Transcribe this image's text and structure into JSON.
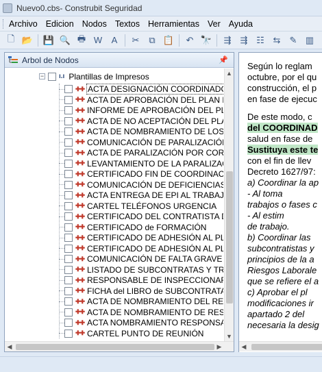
{
  "window": {
    "title": "Nuevo0.cbs- Construbit Seguridad"
  },
  "menu": [
    "Archivo",
    "Edicion",
    "Nodos",
    "Textos",
    "Herramientas",
    "Ver",
    "Ayuda"
  ],
  "toolbar": {
    "buttons": [
      {
        "name": "new-icon",
        "glyph": "🗋"
      },
      {
        "name": "open-folder-icon",
        "glyph": "📂"
      },
      {
        "name": "save-icon",
        "glyph": "💾"
      },
      {
        "name": "print-preview-icon",
        "glyph": "🔍"
      },
      {
        "name": "print-icon",
        "glyph": "🖶"
      },
      {
        "name": "word-export-icon",
        "glyph": "W"
      },
      {
        "name": "pdf-export-icon",
        "glyph": "A"
      },
      {
        "name": "cut-icon",
        "glyph": "✂"
      },
      {
        "name": "copy-icon",
        "glyph": "⧉"
      },
      {
        "name": "paste-icon",
        "glyph": "📋"
      },
      {
        "name": "undo-icon",
        "glyph": "↶"
      },
      {
        "name": "find-icon",
        "glyph": "🔭"
      },
      {
        "name": "node-tool-1-icon",
        "glyph": "⇶"
      },
      {
        "name": "node-tool-2-icon",
        "glyph": "⇶"
      },
      {
        "name": "node-tool-3-icon",
        "glyph": "☷"
      },
      {
        "name": "node-tool-4-icon",
        "glyph": "⇆"
      },
      {
        "name": "edit-doc-icon",
        "glyph": "✎"
      },
      {
        "name": "chart-icon",
        "glyph": "▥"
      }
    ]
  },
  "panel": {
    "title": "Arbol de Nodos",
    "root": {
      "label": "Plantillas de Impresos",
      "expander": "−"
    },
    "items": [
      "ACTA DESIGNACIÓN COORDINADOR",
      "ACTA DE APROBACIÓN DEL PLAN DE S",
      "INFORME DE APROBACIÓN DEL PLAN D",
      "ACTA DE NO ACEPTACIÓN DEL PLAN D",
      "ACTA DE NOMBRAMIENTO DE LOS REC",
      "COMUNICACIÓN DE PARALIZACIÓN DE",
      "ACTA DE PARALIZACIÓN POR CORONA",
      "LEVANTAMIENTO DE LA PARALIZACIÓN",
      "CERTIFICADO FIN DE COORDINACIÓN D",
      "COMUNICACIÓN DE DEFICIENCIAS EN M",
      "ACTA ENTREGA DE EPI AL TRABAJADO",
      "CARTEL TELÉFONOS URGENCIA",
      "CERTIFICADO DEL CONTRATISTA DEL",
      "CERTIFICADO de FORMACIÓN",
      "CERTIFICADO DE ADHESIÓN AL PLAN D",
      "CERTIFICADO DE ADHESIÓN AL PLAN D",
      "COMUNICACIÓN DE FALTA GRAVE",
      "LISTADO DE SUBCONTRATAS Y TRABA",
      "RESPONSABLE DE INSPECCIONAR AND",
      "FICHA del LIBRO de SUBCONTRATACIÓ",
      "ACTA DE NOMBRAMIENTO DEL RESPO",
      "ACTA DE NOMBRAMIENTO DE RESPON",
      "ACTA NOMBRAMIENTO RESPONSABLE",
      "CARTEL PUNTO DE REUNIÓN"
    ]
  },
  "document": {
    "lines": [
      {
        "parts": [
          {
            "t": "Según lo reglam"
          }
        ]
      },
      {
        "parts": [
          {
            "t": "octubre, por el qu"
          }
        ]
      },
      {
        "parts": [
          {
            "t": "construcción, el p"
          }
        ]
      },
      {
        "parts": [
          {
            "t": "en fase de ejecuc"
          }
        ]
      },
      {
        "gap": true
      },
      {
        "parts": [
          {
            "t": "De este modo, c"
          }
        ]
      },
      {
        "parts": [
          {
            "t": "del COORDINAD",
            "s": "hl"
          }
        ]
      },
      {
        "parts": [
          {
            "t": "salud en fase de"
          }
        ]
      },
      {
        "parts": [
          {
            "t": "Sustituya este te",
            "s": "hl"
          }
        ]
      },
      {
        "parts": [
          {
            "t": "con el fin de llev"
          }
        ]
      },
      {
        "parts": [
          {
            "t": "Decreto 1627/97:"
          }
        ]
      },
      {
        "parts": [
          {
            "t": "a) Coordinar la ap",
            "s": "it"
          }
        ]
      },
      {
        "parts": [
          {
            "t": "              - Al toma",
            "s": "it"
          }
        ]
      },
      {
        "parts": [
          {
            "t": "trabajos o fases c",
            "s": "it"
          }
        ]
      },
      {
        "parts": [
          {
            "t": "              - Al estim",
            "s": "it"
          }
        ]
      },
      {
        "parts": [
          {
            "t": "de trabajo.",
            "s": "it"
          }
        ]
      },
      {
        "parts": [
          {
            "t": "b) Coordinar las",
            "s": "it"
          }
        ]
      },
      {
        "parts": [
          {
            "t": "subcontratistas y",
            "s": "it"
          }
        ]
      },
      {
        "parts": [
          {
            "t": "principios de la a",
            "s": "it"
          }
        ]
      },
      {
        "parts": [
          {
            "t": "Riesgos Laborale",
            "s": "it"
          }
        ]
      },
      {
        "parts": [
          {
            "t": "que se refiere el a",
            "s": "it"
          }
        ]
      },
      {
        "parts": [
          {
            "t": "c) Aprobar el pl",
            "s": "it"
          }
        ]
      },
      {
        "parts": [
          {
            "t": "modificaciones ir",
            "s": "it"
          }
        ]
      },
      {
        "parts": [
          {
            "t": "apartado 2 del",
            "s": "it"
          }
        ]
      },
      {
        "parts": [
          {
            "t": "necesaria la desig",
            "s": "it"
          }
        ]
      }
    ]
  }
}
